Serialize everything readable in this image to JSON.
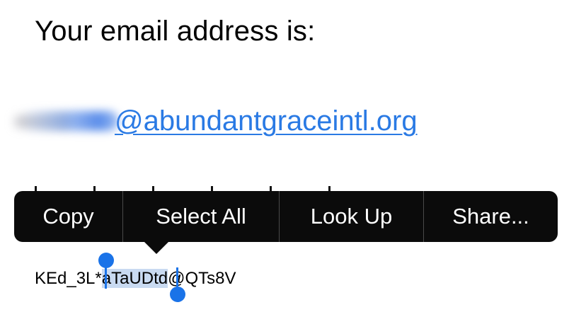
{
  "heading": "Your email address is:",
  "email": {
    "domain_part": "@abundantgraceintl.org",
    "local_part_state": "blurred"
  },
  "context_menu": {
    "items": [
      "Copy",
      "Select All",
      "Look Up",
      "Share..."
    ]
  },
  "text_line": {
    "before": "KEd_3L*",
    "selected": "aTaUDtd",
    "after": "@QTs8V"
  },
  "colors": {
    "link": "#2a7ae4",
    "menu_bg": "#0b0b0b",
    "selection": "#c9daf1",
    "handle": "#1a73e8"
  }
}
